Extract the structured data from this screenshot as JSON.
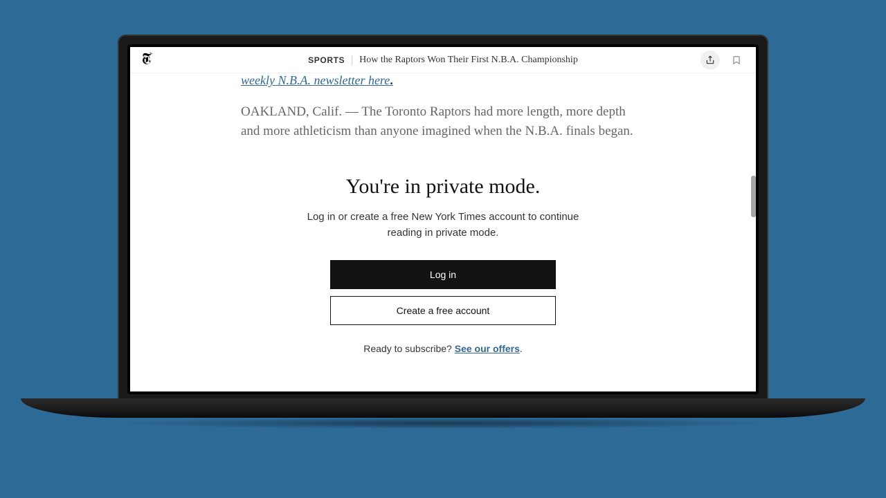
{
  "topbar": {
    "section": "SPORTS",
    "headline": "How the Raptors Won Their First N.B.A. Championship"
  },
  "article": {
    "newsletter_link": "weekly N.B.A. newsletter here",
    "paragraph": "OAKLAND, Calif. — The Toronto Raptors had more length, more depth and more athleticism than anyone imagined when the N.B.A. finals began."
  },
  "paywall": {
    "title": "You're in private mode.",
    "subtitle": "Log in or create a free New York Times account to continue reading in private mode.",
    "login_label": "Log in",
    "create_label": "Create a free account",
    "offer_prefix": "Ready to subscribe? ",
    "offer_link": "See our offers",
    "offer_suffix": "."
  }
}
